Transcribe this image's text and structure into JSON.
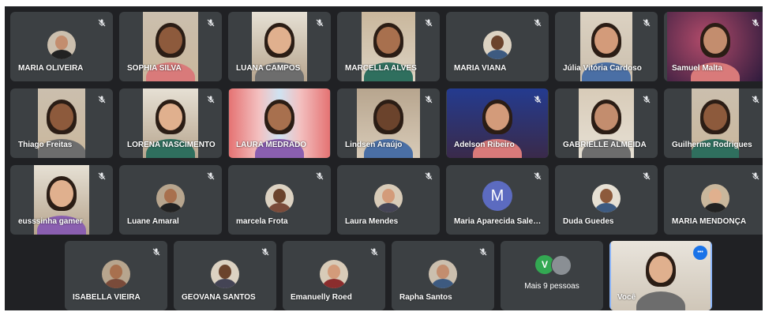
{
  "meeting": {
    "colors": {
      "background": "#202124",
      "tile": "#3c4043",
      "accent": "#1a73e8",
      "speaking_outline": "#8ab4f8"
    },
    "participants": [
      {
        "name": "MARIA OLIVEIRA",
        "kind": "avatar",
        "muted": true
      },
      {
        "name": "SOPHIA SILVA",
        "kind": "video",
        "muted": true
      },
      {
        "name": "LUANA CAMPOS",
        "kind": "video",
        "muted": true
      },
      {
        "name": "MARCELLA ALVES",
        "kind": "video",
        "muted": true
      },
      {
        "name": "MARIA VIANA",
        "kind": "avatar",
        "muted": true
      },
      {
        "name": "Júlia Vitória Cardoso",
        "kind": "video",
        "muted": true
      },
      {
        "name": "Samuel Malta",
        "kind": "video",
        "muted": true
      },
      {
        "name": "Thiago Freitas",
        "kind": "video",
        "muted": true
      },
      {
        "name": "LORENA NASCIMENTO",
        "kind": "video",
        "muted": true
      },
      {
        "name": "LAURA MEDRADO",
        "kind": "video",
        "muted": false
      },
      {
        "name": "Lindsen Araújo",
        "kind": "video",
        "muted": true
      },
      {
        "name": "Adelson Ribeiro",
        "kind": "video",
        "muted": true
      },
      {
        "name": "GABRIELLE ALMEIDA",
        "kind": "video",
        "muted": true
      },
      {
        "name": "Guilherme Rodrigues",
        "kind": "video",
        "muted": true
      },
      {
        "name": "eusssinha gamer",
        "kind": "video",
        "muted": true
      },
      {
        "name": "Luane Amaral",
        "kind": "avatar",
        "muted": true
      },
      {
        "name": "marcela Frota",
        "kind": "avatar",
        "muted": true
      },
      {
        "name": "Laura Mendes",
        "kind": "avatar",
        "muted": true
      },
      {
        "name": "Maria Aparecida Salema",
        "kind": "letter",
        "letter": "M",
        "muted": true
      },
      {
        "name": "Duda Guedes",
        "kind": "avatar",
        "muted": true
      },
      {
        "name": "MARIA MENDONÇA",
        "kind": "avatar",
        "muted": true
      },
      {
        "name": "ISABELLA VIEIRA",
        "kind": "avatar",
        "muted": true
      },
      {
        "name": "GEOVANA SANTOS",
        "kind": "avatar",
        "muted": true
      },
      {
        "name": "Emanuelly Roed",
        "kind": "avatar",
        "muted": true
      },
      {
        "name": "Rapha Santos",
        "kind": "avatar",
        "muted": true
      }
    ],
    "more": {
      "letter": "V",
      "label": "Mais 9 pessoas"
    },
    "self": {
      "name": "Você",
      "options_icon": "more-options-icon"
    }
  }
}
